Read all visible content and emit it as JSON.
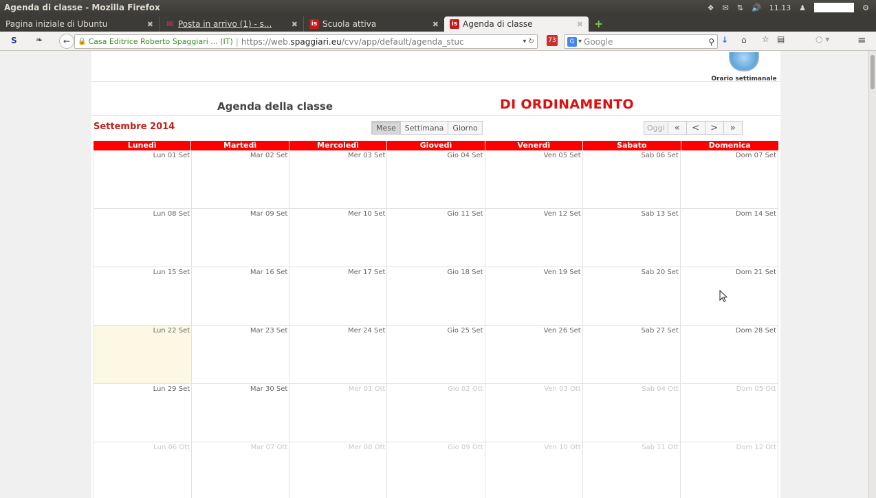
{
  "window": {
    "title": "Agenda di classe - Mozilla Firefox",
    "clock": "11.13"
  },
  "tabs": [
    {
      "label": "Pagina iniziale di Ubuntu",
      "icon": "none"
    },
    {
      "label": "Posta in arrivo (1) - s...",
      "icon": "mail-icon"
    },
    {
      "label": "Scuola attiva",
      "icon": "is-logo-icon"
    },
    {
      "label": "Agenda di classe",
      "icon": "is-logo-icon"
    }
  ],
  "urlbar": {
    "owner": "Casa Editrice Roberto Spaggiari ... (IT)",
    "url_prefix": "https://web.",
    "url_domain": "spaggiari.eu",
    "url_path": "/cvv/app/default/agenda_stuc"
  },
  "searchbar": {
    "placeholder": "Google"
  },
  "page": {
    "orario_label": "Orario settimanale",
    "agenda_title": "Agenda della classe",
    "ordinamento": "DI ORDINAMENTO",
    "month_label": "Settembre 2014",
    "view_buttons": [
      "Mese",
      "Settimana",
      "Giorno"
    ],
    "active_view": "Mese",
    "nav_buttons": {
      "today": "Oggi",
      "prev_year": "«",
      "prev": "<",
      "next": ">",
      "next_year": "»"
    },
    "weekdays": [
      "Lunedì",
      "Martedì",
      "Mercoledì",
      "Giovedì",
      "Venerdì",
      "Sabato",
      "Domenica"
    ],
    "weeks": [
      [
        "Lun 01 Set",
        "Mar 02 Set",
        "Mer 03 Set",
        "Gio 04 Set",
        "Ven 05 Set",
        "Sab 06 Set",
        "Dom 07 Set"
      ],
      [
        "Lun 08 Set",
        "Mar 09 Set",
        "Mer 10 Set",
        "Gio 11 Set",
        "Ven 12 Set",
        "Sab 13 Set",
        "Dom 14 Set"
      ],
      [
        "Lun 15 Set",
        "Mar 16 Set",
        "Mer 17 Set",
        "Gio 18 Set",
        "Ven 19 Set",
        "Sab 20 Set",
        "Dom 21 Set"
      ],
      [
        "Lun 22 Set",
        "Mar 23 Set",
        "Mer 24 Set",
        "Gio 25 Set",
        "Ven 26 Set",
        "Sab 27 Set",
        "Dom 28 Set"
      ],
      [
        "Lun 29 Set",
        "Mar 30 Set",
        "Mer 01 Ott",
        "Gio 02 Ott",
        "Ven 03 Ott",
        "Sab 04 Ott",
        "Dom 05 Ott"
      ],
      [
        "Lun 06 Ott",
        "Mar 07 Ott",
        "Mer 08 Ott",
        "Gio 09 Ott",
        "Ven 10 Ott",
        "Sab 11 Ott",
        "Dom 12 Ott"
      ]
    ],
    "today": "Lun 22 Set",
    "current_month_suffix": "Set",
    "colors": {
      "header_red": "#ff0000",
      "title_red": "#e00e0e",
      "today_bg": "#fcf8e3"
    }
  }
}
